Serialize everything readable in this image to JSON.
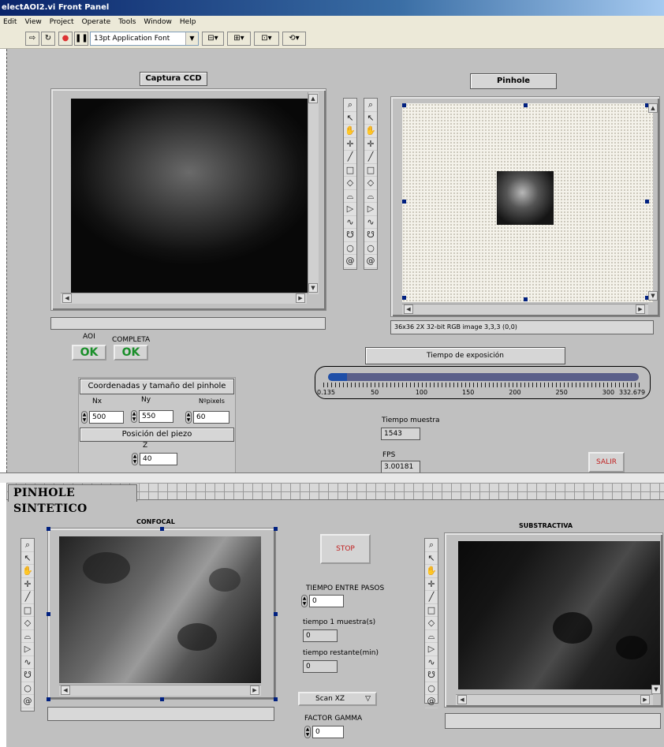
{
  "window": {
    "title": "electAOI2.vi Front Panel"
  },
  "menu": [
    "Edit",
    "View",
    "Project",
    "Operate",
    "Tools",
    "Window",
    "Help"
  ],
  "toolbar": {
    "font": "13pt Application Font"
  },
  "capture": {
    "title": "Captura CCD"
  },
  "pinhole": {
    "title": "Pinhole",
    "info": "36x36 2X 32-bit RGB image 3,3,3    (0,0)"
  },
  "buttons": {
    "aoi_label": "AOI",
    "aoi_text": "OK",
    "completa_label": "COMPLETA",
    "completa_text": "OK",
    "salir": "SALIR",
    "stop": "STOP"
  },
  "coords": {
    "title": "Coordenadas y tamaño del pinhole",
    "nx_label": "Nx",
    "nx": "500",
    "ny_label": "Ny",
    "ny": "550",
    "npix_label": "Nºpixels",
    "npix": "60"
  },
  "piezo": {
    "title": "Posición del piezo",
    "z_label": "Z",
    "z": "40"
  },
  "exposure": {
    "title": "Tiempo de exposición",
    "value": 20,
    "min": 0.135,
    "max": 332.679,
    "ticks": [
      "0.135",
      "50",
      "100",
      "150",
      "200",
      "250",
      "300",
      "332.679"
    ]
  },
  "tiempo_muestra": {
    "label": "Tiempo muestra",
    "value": "1543"
  },
  "fps": {
    "label": "FPS",
    "value": "3.00181"
  },
  "tab": {
    "label": "PINHOLE SINTETICO"
  },
  "confocal": {
    "title": "CONFOCAL"
  },
  "substractiva": {
    "title": "SUBSTRACTIVA"
  },
  "tiempo_pasos": {
    "label": "TIEMPO ENTRE PASOS",
    "value": "0"
  },
  "tiempo_muestra1": {
    "label": "tiempo 1 muestra(s)",
    "value": "0"
  },
  "tiempo_restante": {
    "label": "tiempo restante(min)",
    "value": "0"
  },
  "scan": {
    "value": "Scan XZ"
  },
  "gamma": {
    "label": "FACTOR GAMMA",
    "value": "0"
  }
}
